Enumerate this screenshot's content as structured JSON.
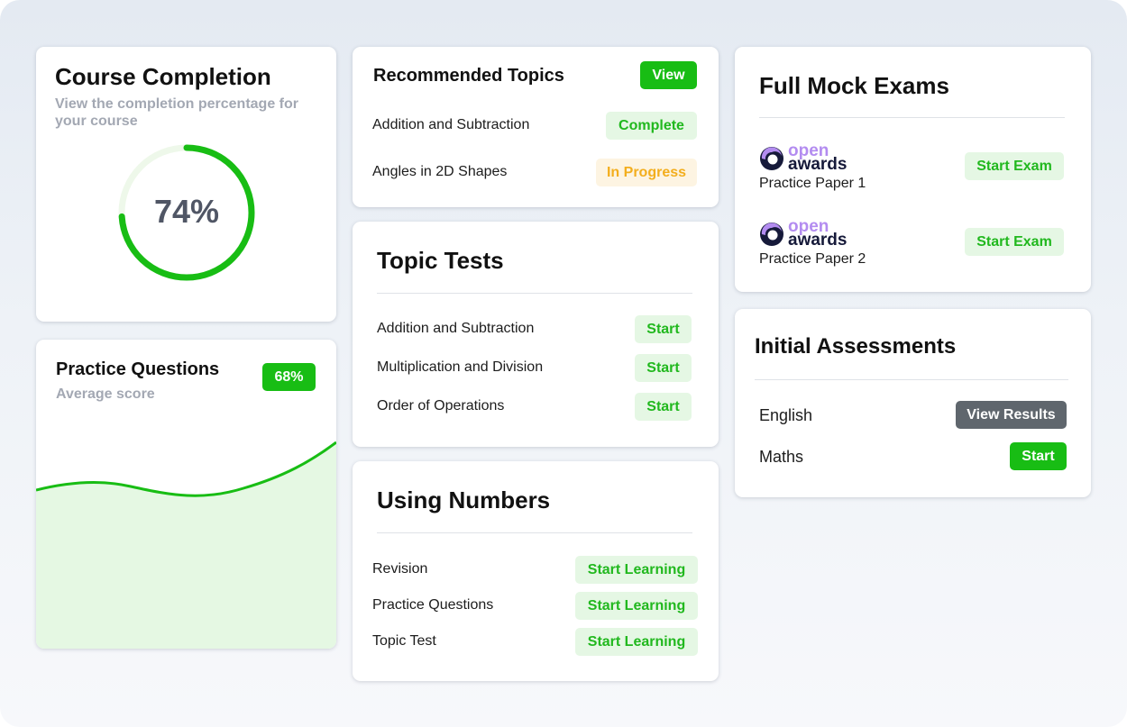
{
  "course_completion": {
    "title": "Course Completion",
    "subtitle": "View the completion percentage for your course",
    "percent_label": "74%",
    "percent_value": 0.74,
    "ring_color": "#18bd14",
    "ring_track_color": "#eef8ea"
  },
  "practice_questions": {
    "title": "Practice Questions",
    "subtitle": "Average score",
    "score_badge": "68%",
    "line_color": "#18bd14",
    "fill_color": "#e5f8e3"
  },
  "recommended_topics": {
    "title": "Recommended Topics",
    "view_label": "View",
    "items": [
      {
        "label": "Addition and Subtraction",
        "status": "Complete"
      },
      {
        "label": "Angles in 2D Shapes",
        "status": "In Progress"
      }
    ]
  },
  "topic_tests": {
    "title": "Topic Tests",
    "items": [
      {
        "label": "Addition and Subtraction",
        "action": "Start"
      },
      {
        "label": "Multiplication and Division",
        "action": "Start"
      },
      {
        "label": "Order of Operations",
        "action": "Start"
      }
    ]
  },
  "using_numbers": {
    "title": "Using Numbers",
    "items": [
      {
        "label": "Revision",
        "action": "Start Learning"
      },
      {
        "label": "Practice Questions",
        "action": "Start Learning"
      },
      {
        "label": "Topic Test",
        "action": "Start Learning"
      }
    ]
  },
  "full_mock_exams": {
    "title": "Full Mock Exams",
    "items": [
      {
        "logo_top": "open",
        "logo_bottom": "awards",
        "label": "Practice Paper 1",
        "action": "Start Exam"
      },
      {
        "logo_top": "open",
        "logo_bottom": "awards",
        "label": "Practice Paper 2",
        "action": "Start Exam"
      }
    ]
  },
  "initial_assessments": {
    "title": "Initial Assessments",
    "items": [
      {
        "label": "English",
        "action": "View Results"
      },
      {
        "label": "Maths",
        "action": "Start"
      }
    ]
  },
  "icons": {
    "open_awards_logo": "open-awards-logo-icon"
  }
}
